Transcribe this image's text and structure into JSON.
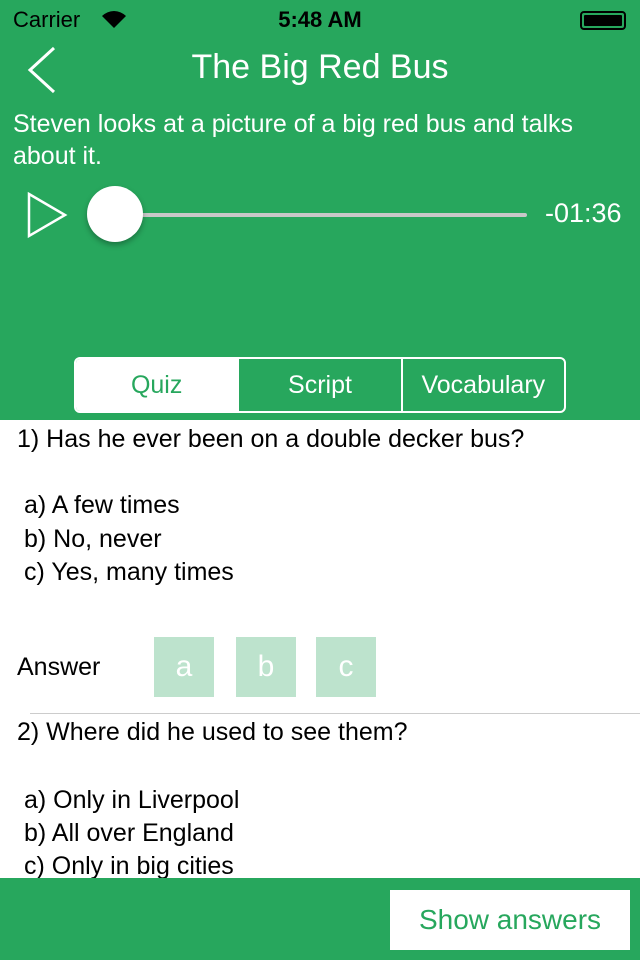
{
  "status_bar": {
    "carrier": "Carrier",
    "time": "5:48 AM"
  },
  "header": {
    "title": "The Big Red Bus",
    "description": "Steven looks at a picture of a big red bus and talks about it."
  },
  "player": {
    "remaining": "-01:36",
    "progress": 0
  },
  "tabs": [
    {
      "label": "Quiz",
      "active": true
    },
    {
      "label": "Script"
    },
    {
      "label": "Vocabulary"
    }
  ],
  "questions": [
    {
      "text": "1) Has he ever been on a double decker bus?",
      "options": [
        "a) A few times",
        "b) No, never",
        "c) Yes, many times"
      ],
      "answer_label": "Answer",
      "choices": [
        "a",
        "b",
        "c"
      ]
    },
    {
      "text": "2) Where did he used to see them?",
      "options": [
        "a) Only in Liverpool",
        "b) All over England",
        "c) Only in big cities"
      ]
    }
  ],
  "footer": {
    "show_answers": "Show answers"
  },
  "colors": {
    "primary": "#27a75d",
    "choice_bg": "#bde3cd"
  }
}
